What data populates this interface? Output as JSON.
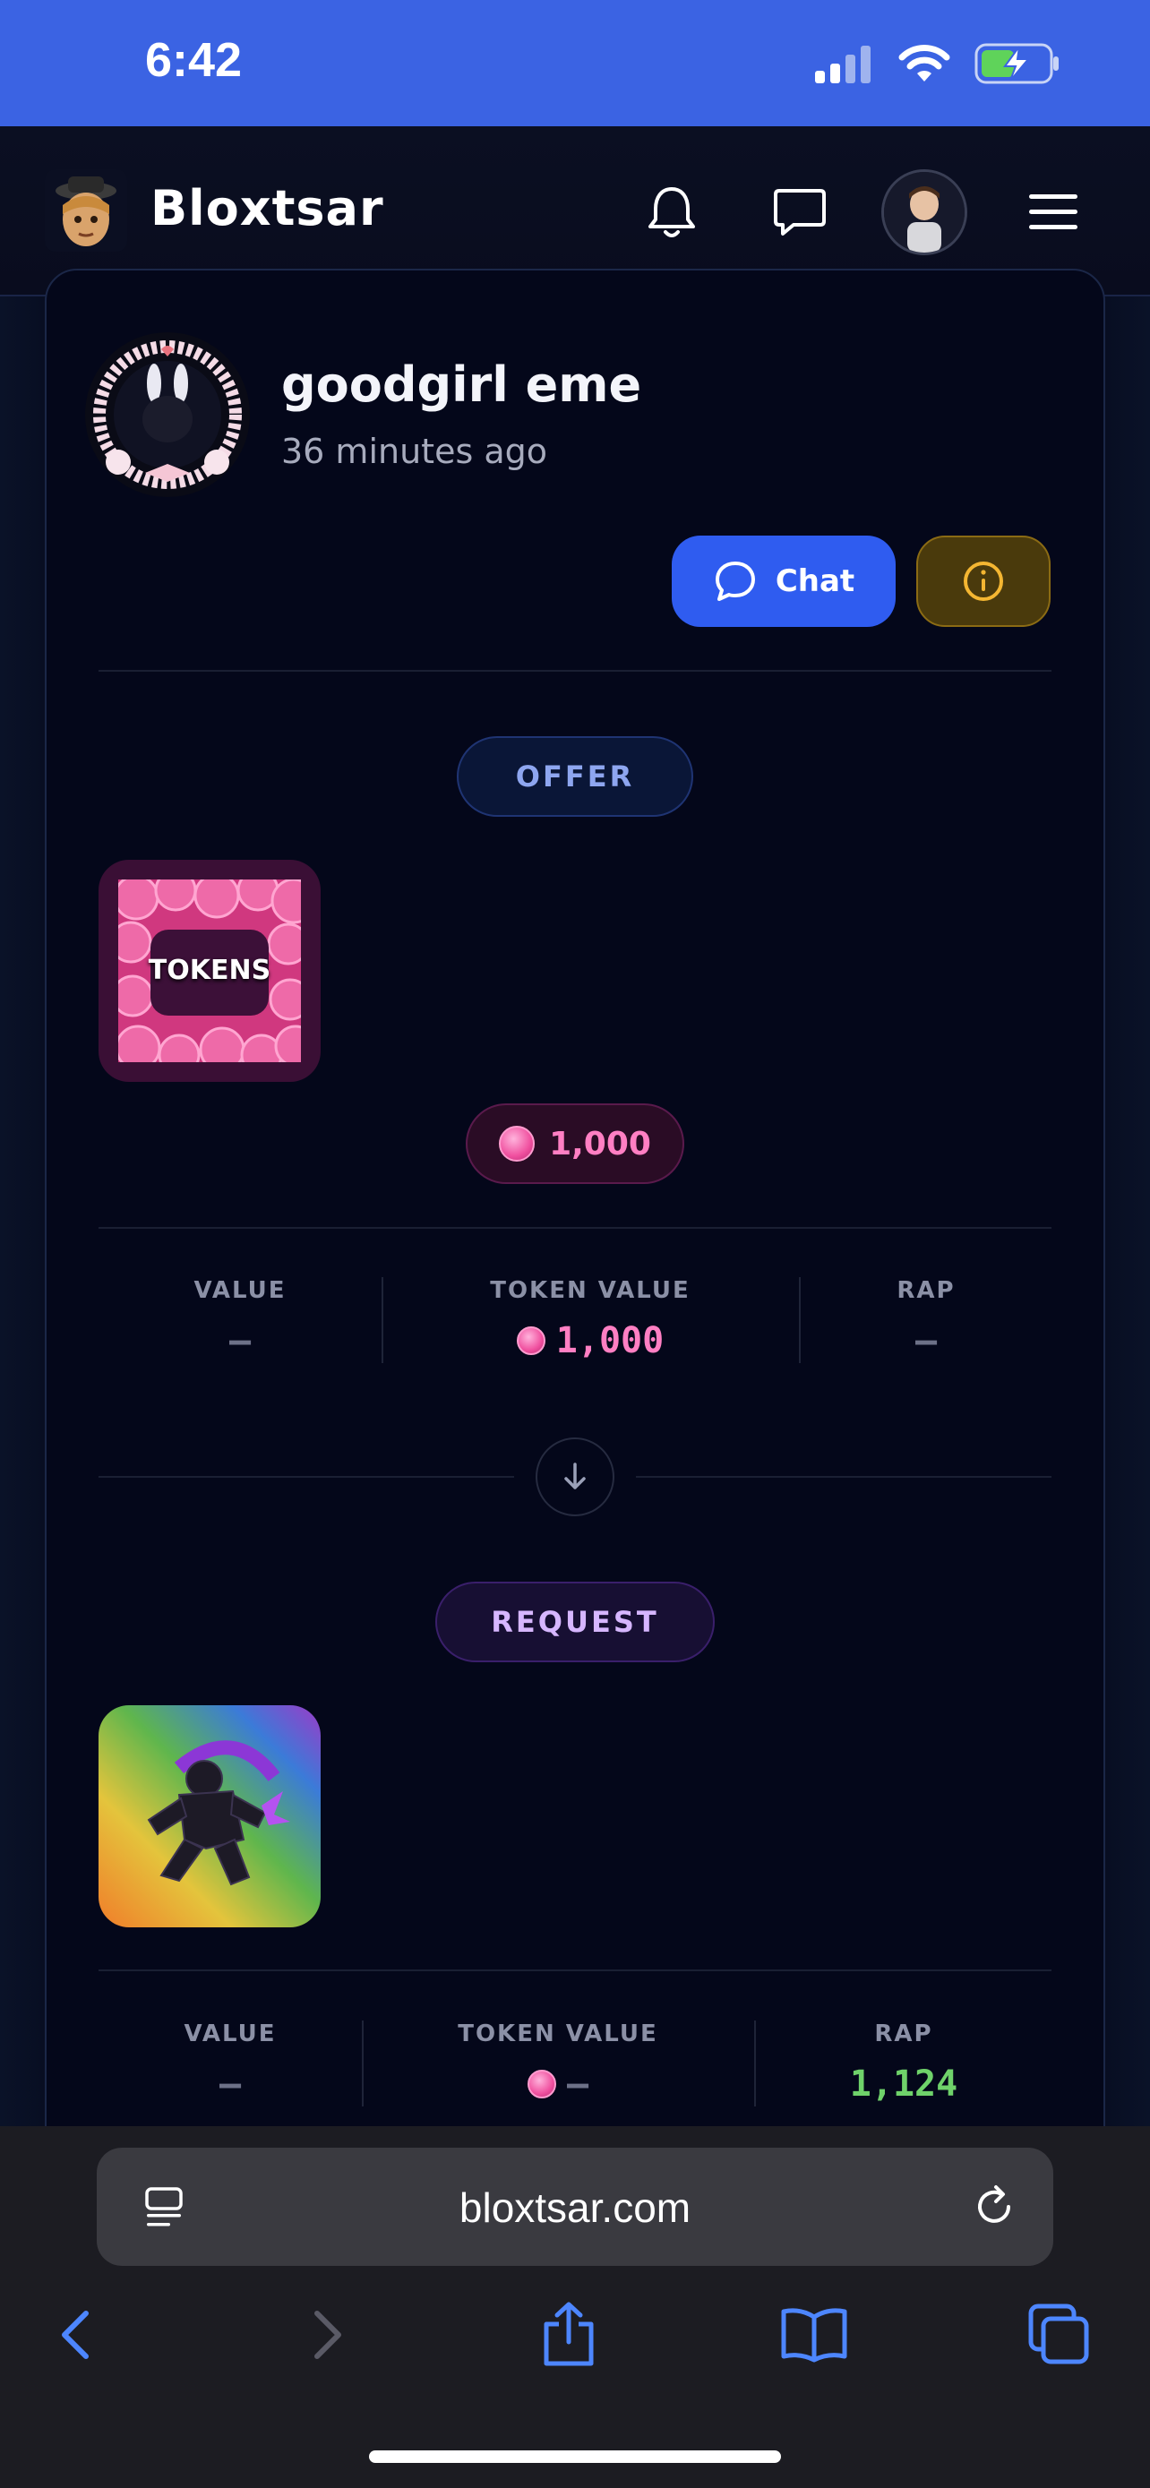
{
  "status_bar": {
    "time": "6:42"
  },
  "header": {
    "brand": "Bloxtsar",
    "icons": [
      "bell-icon",
      "chat-bubble-icon",
      "user-avatar",
      "hamburger-menu-icon"
    ]
  },
  "trade": {
    "poster": {
      "name": "goodgirl eme",
      "time_ago": "36 minutes ago"
    },
    "chat_label": "Chat",
    "offer": {
      "section_label": "OFFER",
      "item_label": "TOKENS",
      "token_amount": "1,000",
      "stats": {
        "value_label": "VALUE",
        "value": "–",
        "token_value_label": "TOKEN VALUE",
        "token_value": "1,000",
        "rap_label": "RAP",
        "rap": "–"
      }
    },
    "request": {
      "section_label": "REQUEST",
      "stats": {
        "value_label": "VALUE",
        "value": "–",
        "token_value_label": "TOKEN VALUE",
        "token_value": "–",
        "rap_label": "RAP",
        "rap": "1,124"
      }
    }
  },
  "browser": {
    "url": "bloxtsar.com"
  },
  "colors": {
    "status_bar": "#3b63e3",
    "chat_button": "#2f5cf0",
    "token_pink": "#ff7fc3",
    "rap_green": "#6fd26a"
  }
}
